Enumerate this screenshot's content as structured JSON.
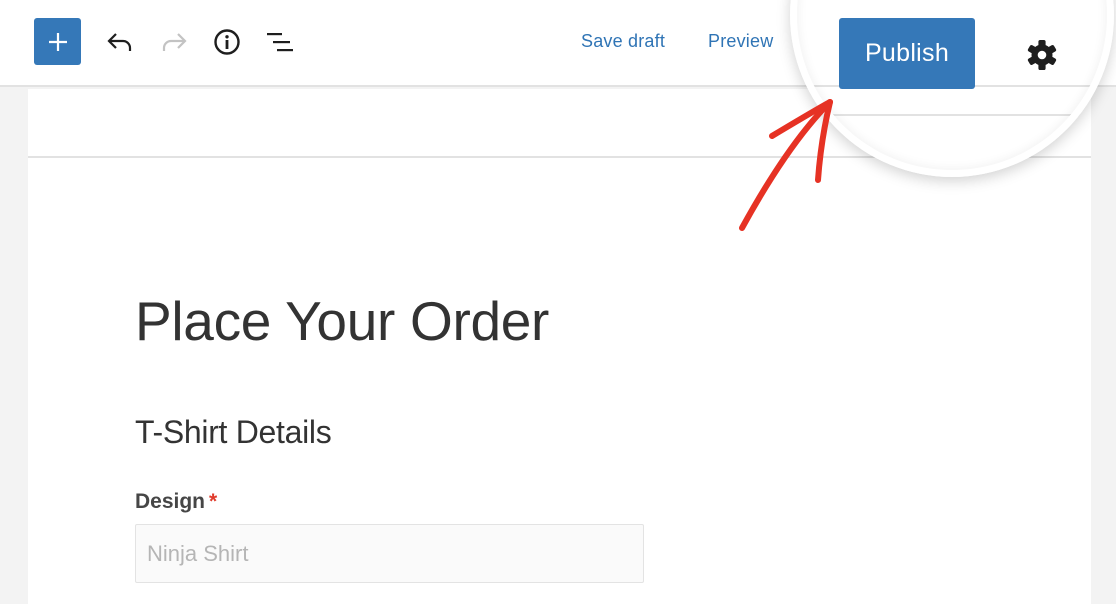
{
  "toolbar": {
    "inserter_icon": "plus-icon",
    "undo_icon": "undo-icon",
    "redo_icon": "redo-icon",
    "info_icon": "info-icon",
    "outline_icon": "list-view-icon",
    "save_draft_label": "Save draft",
    "preview_label": "Preview",
    "publish_label": "Publish",
    "settings_icon": "gear-icon"
  },
  "colors": {
    "accent": "#3578b8",
    "link": "#2f74b5",
    "annotation_arrow": "#e63224",
    "required": "#e03a2b"
  },
  "content": {
    "page_title": "Place Your Order",
    "section_title": "T-Shirt Details",
    "fields": [
      {
        "label": "Design",
        "required_marker": "*",
        "placeholder": "Ninja Shirt",
        "value": ""
      }
    ]
  },
  "annotation": {
    "type": "magnifier-with-arrow",
    "highlights": "publish-button"
  }
}
